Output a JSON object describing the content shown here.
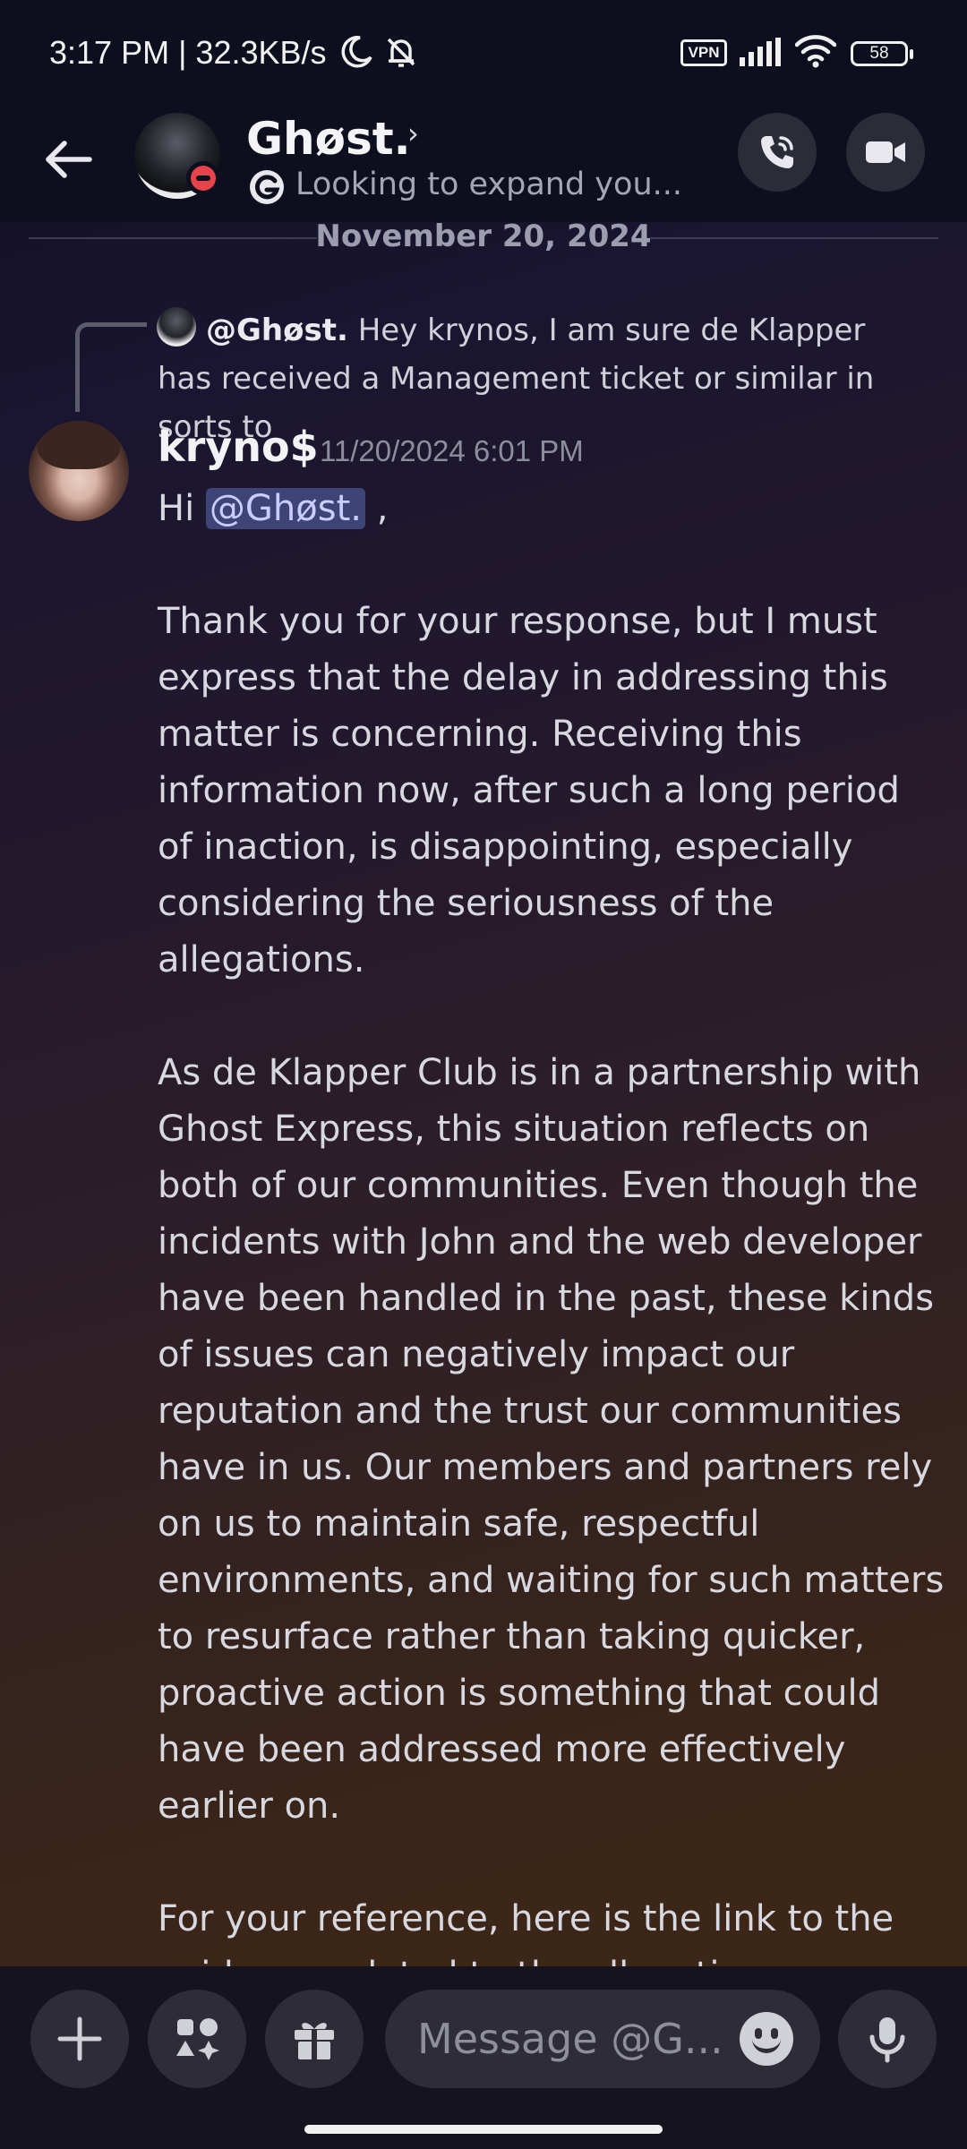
{
  "status_bar": {
    "time_speed": "3:17 PM | 32.3KB/s",
    "vpn_label": "VPN",
    "battery": "58",
    "icons": [
      "moon-icon",
      "bell-off-icon",
      "signal-icon",
      "wifi-icon",
      "battery-icon"
    ]
  },
  "header": {
    "name": "Ghøst.",
    "status": "Looking to expand you...",
    "icons": [
      "back-arrow-icon",
      "phone-call-icon",
      "video-camera-icon",
      "dnd-status-icon",
      "custom-status-icon"
    ],
    "dnd_color": "#e8424a"
  },
  "conversation": {
    "date_divider": "November 20, 2024",
    "reply": {
      "author": "@Ghøst.",
      "text": "Hey krynos, I am sure de Klapper has received a Management ticket or similar in sorts to"
    },
    "message": {
      "author": "kryno$",
      "timestamp": "11/20/2024 6:01 PM",
      "greeting_prefix": "Hi",
      "mention": "@Ghøst.",
      "greeting_suffix": ",",
      "paragraph_1": "Thank you for your response, but I must express that the delay in addressing this matter is concerning. Receiving this information now, after such a long period of inaction, is disappointing, especially considering the seriousness of the allegations.",
      "paragraph_2": "As de Klapper Club is in a partnership with Ghost Express, this situation reflects on both of our communities. Even though the incidents with John and the web developer have been handled in the past, these kinds of issues can negatively impact our reputation and the trust our communities have in us. Our members and partners rely on us to maintain safe, respectful environments, and waiting for such matters to resurface rather than taking quicker, proactive action is something that could have been addressed more effectively earlier on.",
      "paragraph_3": "For your reference, here is the link to the evidence related to the allegations:"
    }
  },
  "input_bar": {
    "placeholder": "Message @G...",
    "icons": [
      "plus-icon",
      "apps-icon",
      "gift-icon",
      "emoji-icon",
      "microphone-icon"
    ]
  },
  "colors": {
    "mention_bg": "#3e4378",
    "link": "#3fa2ff",
    "header_bg": "#0e0f1e"
  }
}
